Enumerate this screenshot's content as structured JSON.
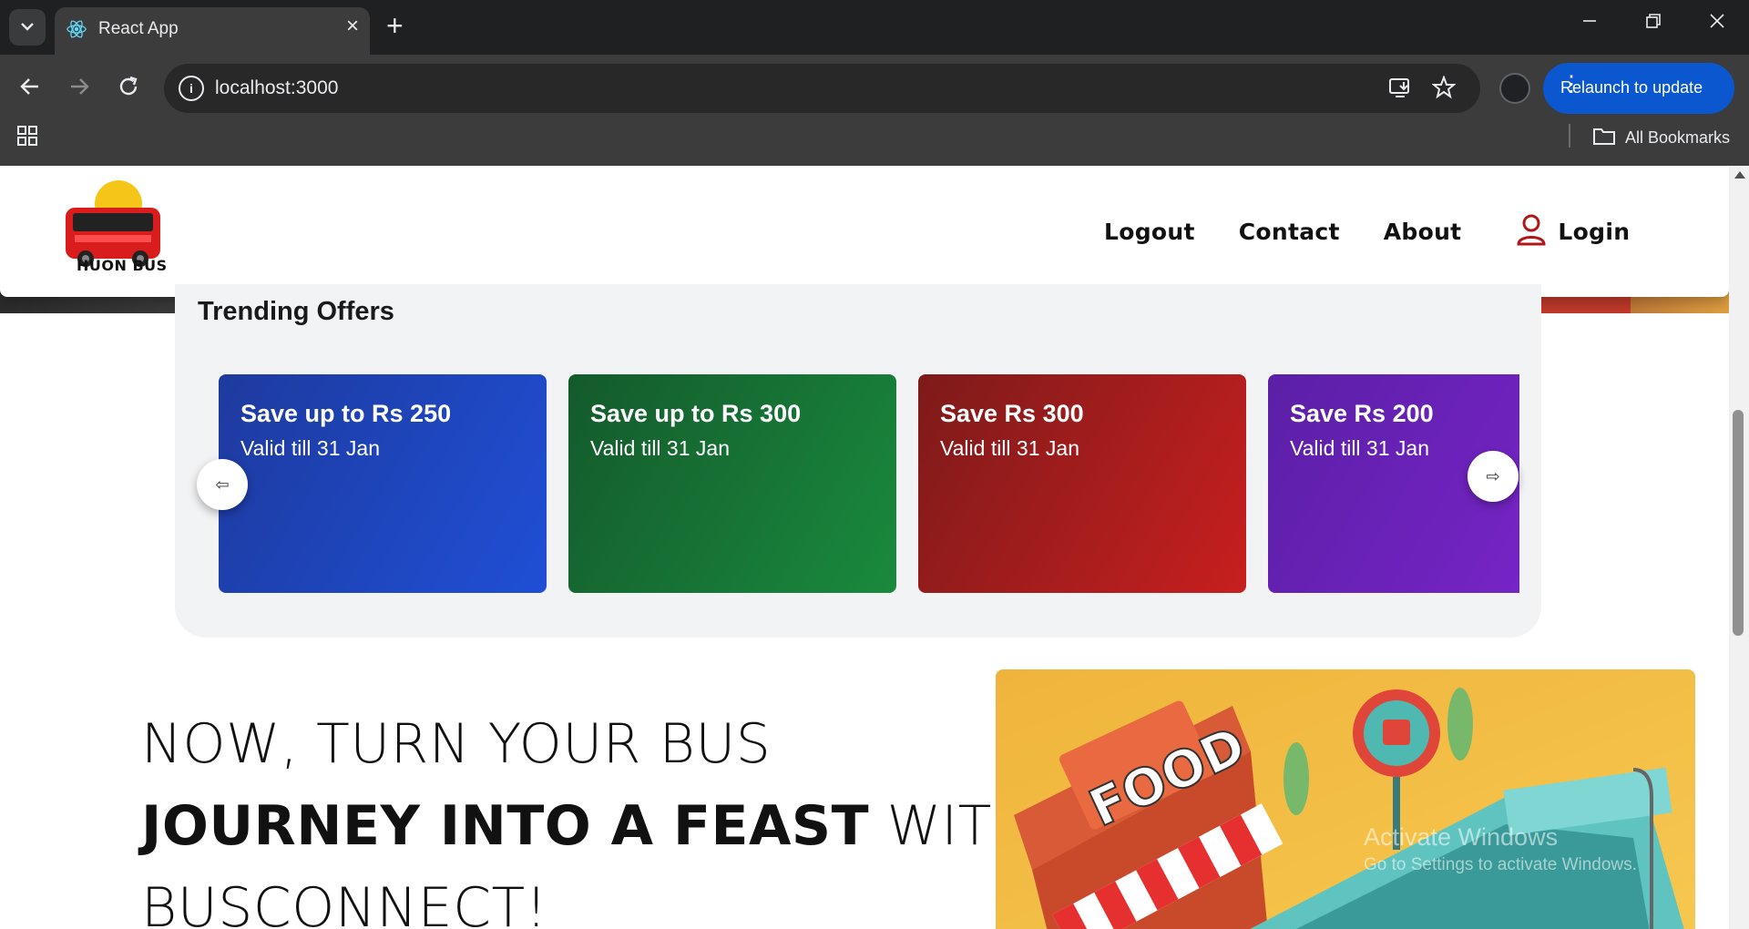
{
  "browser": {
    "tab_title": "React App",
    "url": "localhost:3000",
    "relaunch_label": "Relaunch to update",
    "bookmarks_label": "All Bookmarks"
  },
  "navbar": {
    "logo_text": "HUON BUS",
    "links": [
      "Logout",
      "Contact",
      "About"
    ],
    "login_label": "Login"
  },
  "offers": {
    "title": "Trending Offers",
    "prev_arrow": "⇦",
    "next_arrow": "⇨",
    "cards": [
      {
        "title": "Save up to Rs 250",
        "validity": "Valid till 31 Jan",
        "color": "#1d3fbf"
      },
      {
        "title": "Save up to Rs 300",
        "validity": "Valid till 31 Jan",
        "color": "#167a35"
      },
      {
        "title": "Save Rs 300",
        "validity": "Valid till 31 Jan",
        "color": "#a51e1e"
      },
      {
        "title": "Save Rs 200",
        "validity": "Valid till 31 Jan",
        "color": "#6a20b8"
      }
    ]
  },
  "feature": {
    "line1": "NOW, TURN YOUR BUS",
    "line2_bold": "JOURNEY INTO A FEAST",
    "line2_rest": " WITH",
    "line3": "BUSCONNECT!",
    "image_sign": "FOOD"
  },
  "watermark": {
    "line1": "Activate Windows",
    "line2": "Go to Settings to activate Windows."
  }
}
